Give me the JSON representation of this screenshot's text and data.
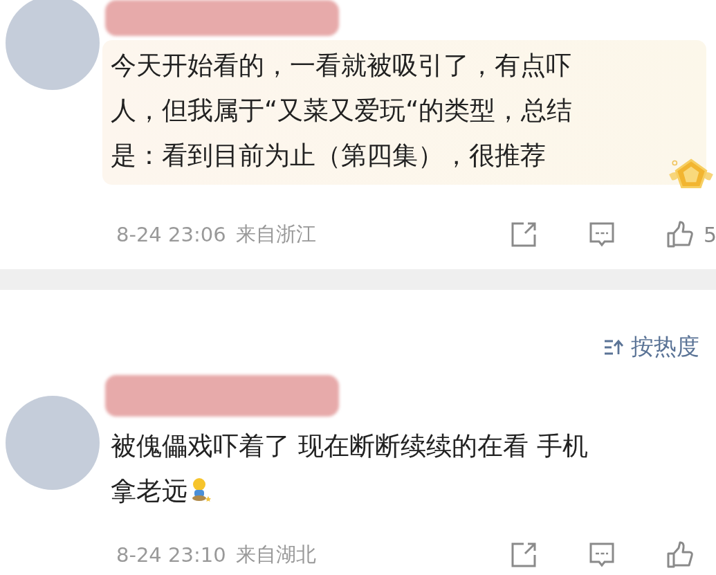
{
  "comments": [
    {
      "lines": [
        "今天开始看的，一看就被吸引了，有点吓",
        "人，但我属于“又菜又爱玩“的类型，总结",
        "是：看到目前为止（第四集），很推荐"
      ],
      "highlighted": true,
      "emoji": false,
      "time": "8-24 23:06",
      "location": "来自浙江",
      "likes": "5"
    },
    {
      "lines": [
        "被傀儡戏吓着了 现在断断续续的在看 手机",
        "拿老远"
      ],
      "highlighted": false,
      "emoji": true,
      "time": "8-24 23:10",
      "location": "来自湖北"
    }
  ],
  "sort": {
    "label": "按热度"
  }
}
